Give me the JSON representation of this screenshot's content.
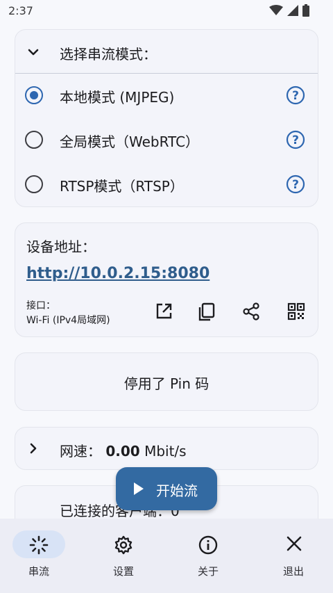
{
  "status_bar": {
    "time": "2:37"
  },
  "mode_section": {
    "title": "选择串流模式：",
    "options": [
      {
        "label": "本地模式 (MJPEG)",
        "selected": true
      },
      {
        "label": "全局模式（WebRTC）",
        "selected": false
      },
      {
        "label": "RTSP模式（RTSP）",
        "selected": false
      }
    ]
  },
  "address_section": {
    "title": "设备地址：",
    "url": "http://10.0.2.15:8080",
    "interface_label": "接口：",
    "interface_value": "Wi-Fi (IPv4局域网)",
    "actions": [
      "open-external-icon",
      "copy-icon",
      "share-icon",
      "qr-code-icon"
    ]
  },
  "pin_section": {
    "text": "停用了 Pin 码"
  },
  "speed_section": {
    "label": "网速：",
    "value": "0.00",
    "unit": "Mbit/s"
  },
  "clients_section": {
    "text": "已连接的客户端：0"
  },
  "fab": {
    "label": "开始流"
  },
  "bottom_nav": {
    "items": [
      {
        "label": "串流",
        "icon": "stream-icon",
        "active": true
      },
      {
        "label": "设置",
        "icon": "settings-gear-icon",
        "active": false
      },
      {
        "label": "关于",
        "icon": "info-icon",
        "active": false
      },
      {
        "label": "退出",
        "icon": "close-icon",
        "active": false
      }
    ]
  },
  "colors": {
    "accent": "#336aa2",
    "link": "#2f5d8c",
    "background": "#f7f8fc"
  }
}
